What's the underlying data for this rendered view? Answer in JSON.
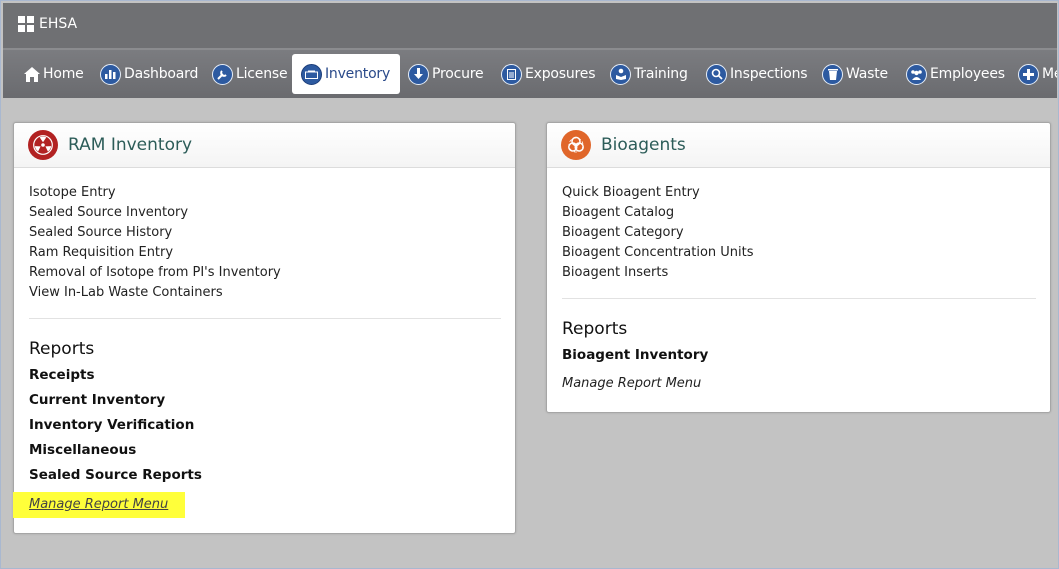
{
  "app": {
    "title": "EHSA"
  },
  "nav": {
    "items": [
      {
        "label": "Home",
        "icon": "home-icon"
      },
      {
        "label": "Dashboard",
        "icon": "bar-chart-icon"
      },
      {
        "label": "License",
        "icon": "wrench-icon"
      },
      {
        "label": "Inventory",
        "icon": "inventory-icon",
        "active": true
      },
      {
        "label": "Procure",
        "icon": "arrow-down-icon"
      },
      {
        "label": "Exposures",
        "icon": "clipboard-icon"
      },
      {
        "label": "Training",
        "icon": "person-reading-icon"
      },
      {
        "label": "Inspections",
        "icon": "magnifier-icon"
      },
      {
        "label": "Waste",
        "icon": "trash-can-icon"
      },
      {
        "label": "Employees",
        "icon": "group-icon"
      },
      {
        "label": "Me",
        "icon": "plus-icon"
      }
    ]
  },
  "ram_panel": {
    "title": "RAM Inventory",
    "icon": "radiation-icon",
    "icon_color": "#b22222",
    "links": [
      "Isotope Entry",
      "Sealed Source Inventory",
      "Sealed Source History",
      "Ram Requisition Entry",
      "Removal of Isotope from PI's Inventory",
      "View In-Lab Waste Containers"
    ],
    "reports_title": "Reports",
    "reports": [
      "Receipts",
      "Current Inventory",
      "Inventory Verification",
      "Miscellaneous",
      "Sealed Source Reports"
    ],
    "manage_link": "Manage Report Menu",
    "highlight_color": "#ffff3a"
  },
  "bio_panel": {
    "title": "Bioagents",
    "icon": "biohazard-icon",
    "icon_color": "#e0662a",
    "links": [
      "Quick Bioagent Entry",
      "Bioagent Catalog",
      "Bioagent Category",
      "Bioagent Concentration Units",
      "Bioagent Inserts"
    ],
    "reports_title": "Reports",
    "reports": [
      "Bioagent Inventory"
    ],
    "manage_link": "Manage Report Menu"
  }
}
